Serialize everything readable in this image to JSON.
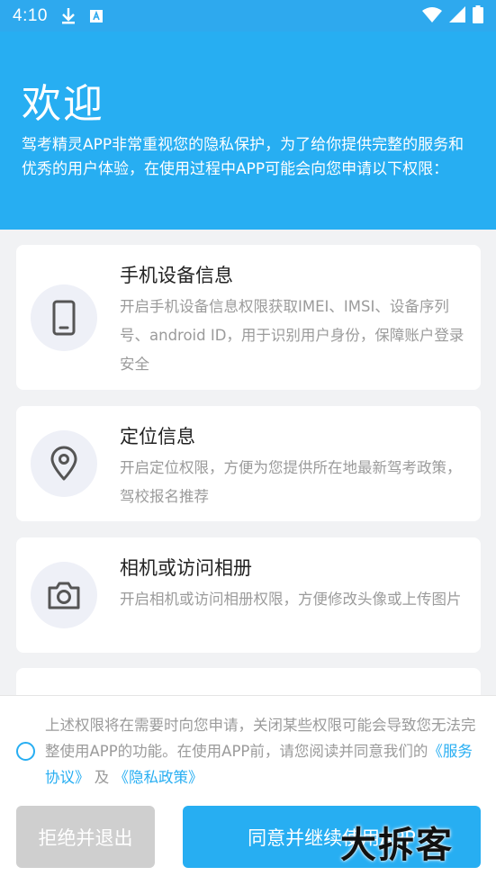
{
  "status_bar": {
    "time": "4:10",
    "icons": [
      "download-icon",
      "text-a-icon",
      "wifi-icon",
      "signal-icon",
      "battery-icon"
    ]
  },
  "header": {
    "title": "欢迎",
    "description": "驾考精灵APP非常重视您的隐私保护，为了给你提供完整的服务和优秀的用户体验，在使用过程中APP可能会向您申请以下权限："
  },
  "permissions": [
    {
      "icon": "phone-icon",
      "title": "手机设备信息",
      "description": "开启手机设备信息权限获取IMEI、IMSI、设备序列号、android ID，用于识别用户身份，保障账户登录安全"
    },
    {
      "icon": "location-pin-icon",
      "title": "定位信息",
      "description": "开启定位权限，方便为您提供所在地最新驾考政策，驾校报名推荐"
    },
    {
      "icon": "camera-icon",
      "title": "相机或访问相册",
      "description": "开启相机或访问相册权限，方便修改头像或上传图片"
    }
  ],
  "consent": {
    "text_before": "上述权限将在需要时向您申请，关闭某些权限可能会导致您无法完整使用APP的功能。在使用APP前，请您阅读并同意我们的",
    "service_link": "《服务协议》",
    "connector": " 及 ",
    "privacy_link": "《隐私政策》"
  },
  "buttons": {
    "reject": "拒绝并退出",
    "agree": "同意并继续使用APP"
  },
  "watermark": "大拆客",
  "colors": {
    "accent": "#27aef2",
    "background": "#f1f2f4",
    "muted_text": "#9b9b9b",
    "reject_button": "#cfcfcf"
  }
}
